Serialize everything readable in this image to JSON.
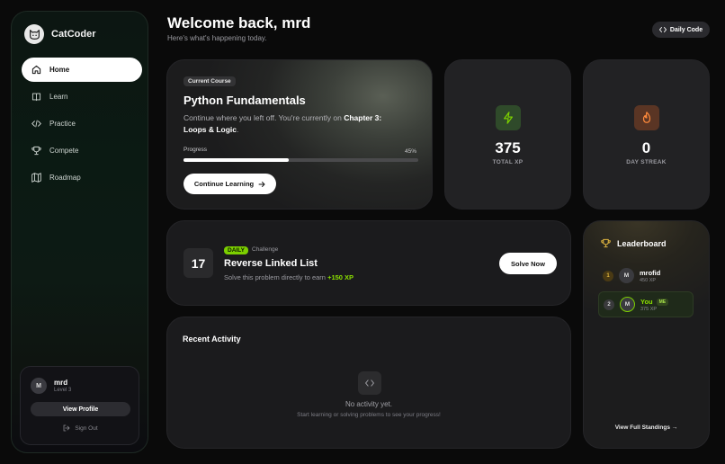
{
  "app": {
    "name": "CatCoder"
  },
  "header": {
    "welcome": "Welcome back, mrd",
    "subtitle": "Here's what's happening today.",
    "daily_code_label": "Daily Code"
  },
  "sidebar": {
    "items": [
      {
        "label": "Home",
        "icon": "home-icon",
        "active": true
      },
      {
        "label": "Learn",
        "icon": "book-icon",
        "active": false
      },
      {
        "label": "Practice",
        "icon": "code-icon",
        "active": false
      },
      {
        "label": "Compete",
        "icon": "trophy-icon",
        "active": false
      },
      {
        "label": "Roadmap",
        "icon": "map-icon",
        "active": false
      }
    ],
    "user": {
      "avatar_initial": "M",
      "name": "mrd",
      "level": "Level 3",
      "view_profile_label": "View Profile",
      "sign_out_label": "Sign Out"
    }
  },
  "course": {
    "badge": "Current Course",
    "title": "Python Fundamentals",
    "desc_prefix": "Continue where you left off. You're currently on ",
    "desc_chapter": "Chapter 3: Loops & Logic",
    "desc_suffix": ".",
    "progress_label": "Progress",
    "progress_pct": "45%",
    "progress_value": 0.45,
    "continue_label": "Continue Learning"
  },
  "stats": {
    "xp": {
      "value": "375",
      "label": "TOTAL XP",
      "icon": "lightning-icon",
      "color": "#7ccf00"
    },
    "streak": {
      "value": "0",
      "label": "DAY STREAK",
      "icon": "flame-icon",
      "color": "#ff8a3c"
    }
  },
  "challenge": {
    "day": "17",
    "badge": "DAILY",
    "tag": "Challenge",
    "title": "Reverse Linked List",
    "desc_prefix": "Solve this problem directly to earn ",
    "xp_reward": "+150 XP",
    "solve_label": "Solve Now"
  },
  "activity": {
    "title": "Recent Activity",
    "empty_title": "No activity yet.",
    "empty_desc": "Start learning or solving problems to see your progress!"
  },
  "leaderboard": {
    "title": "Leaderboard",
    "rows": [
      {
        "rank": "1",
        "initial": "M",
        "name": "mrofid",
        "xp": "450 XP",
        "is_me": false
      },
      {
        "rank": "2",
        "initial": "M",
        "name": "You",
        "xp": "375 XP",
        "is_me": true,
        "me_badge": "ME"
      }
    ],
    "full_standings_label": "View Full Standings"
  },
  "colors": {
    "accent_green": "#7ccf00",
    "streak_orange": "#ff8a3c",
    "leader_gold": "#e0b640"
  }
}
